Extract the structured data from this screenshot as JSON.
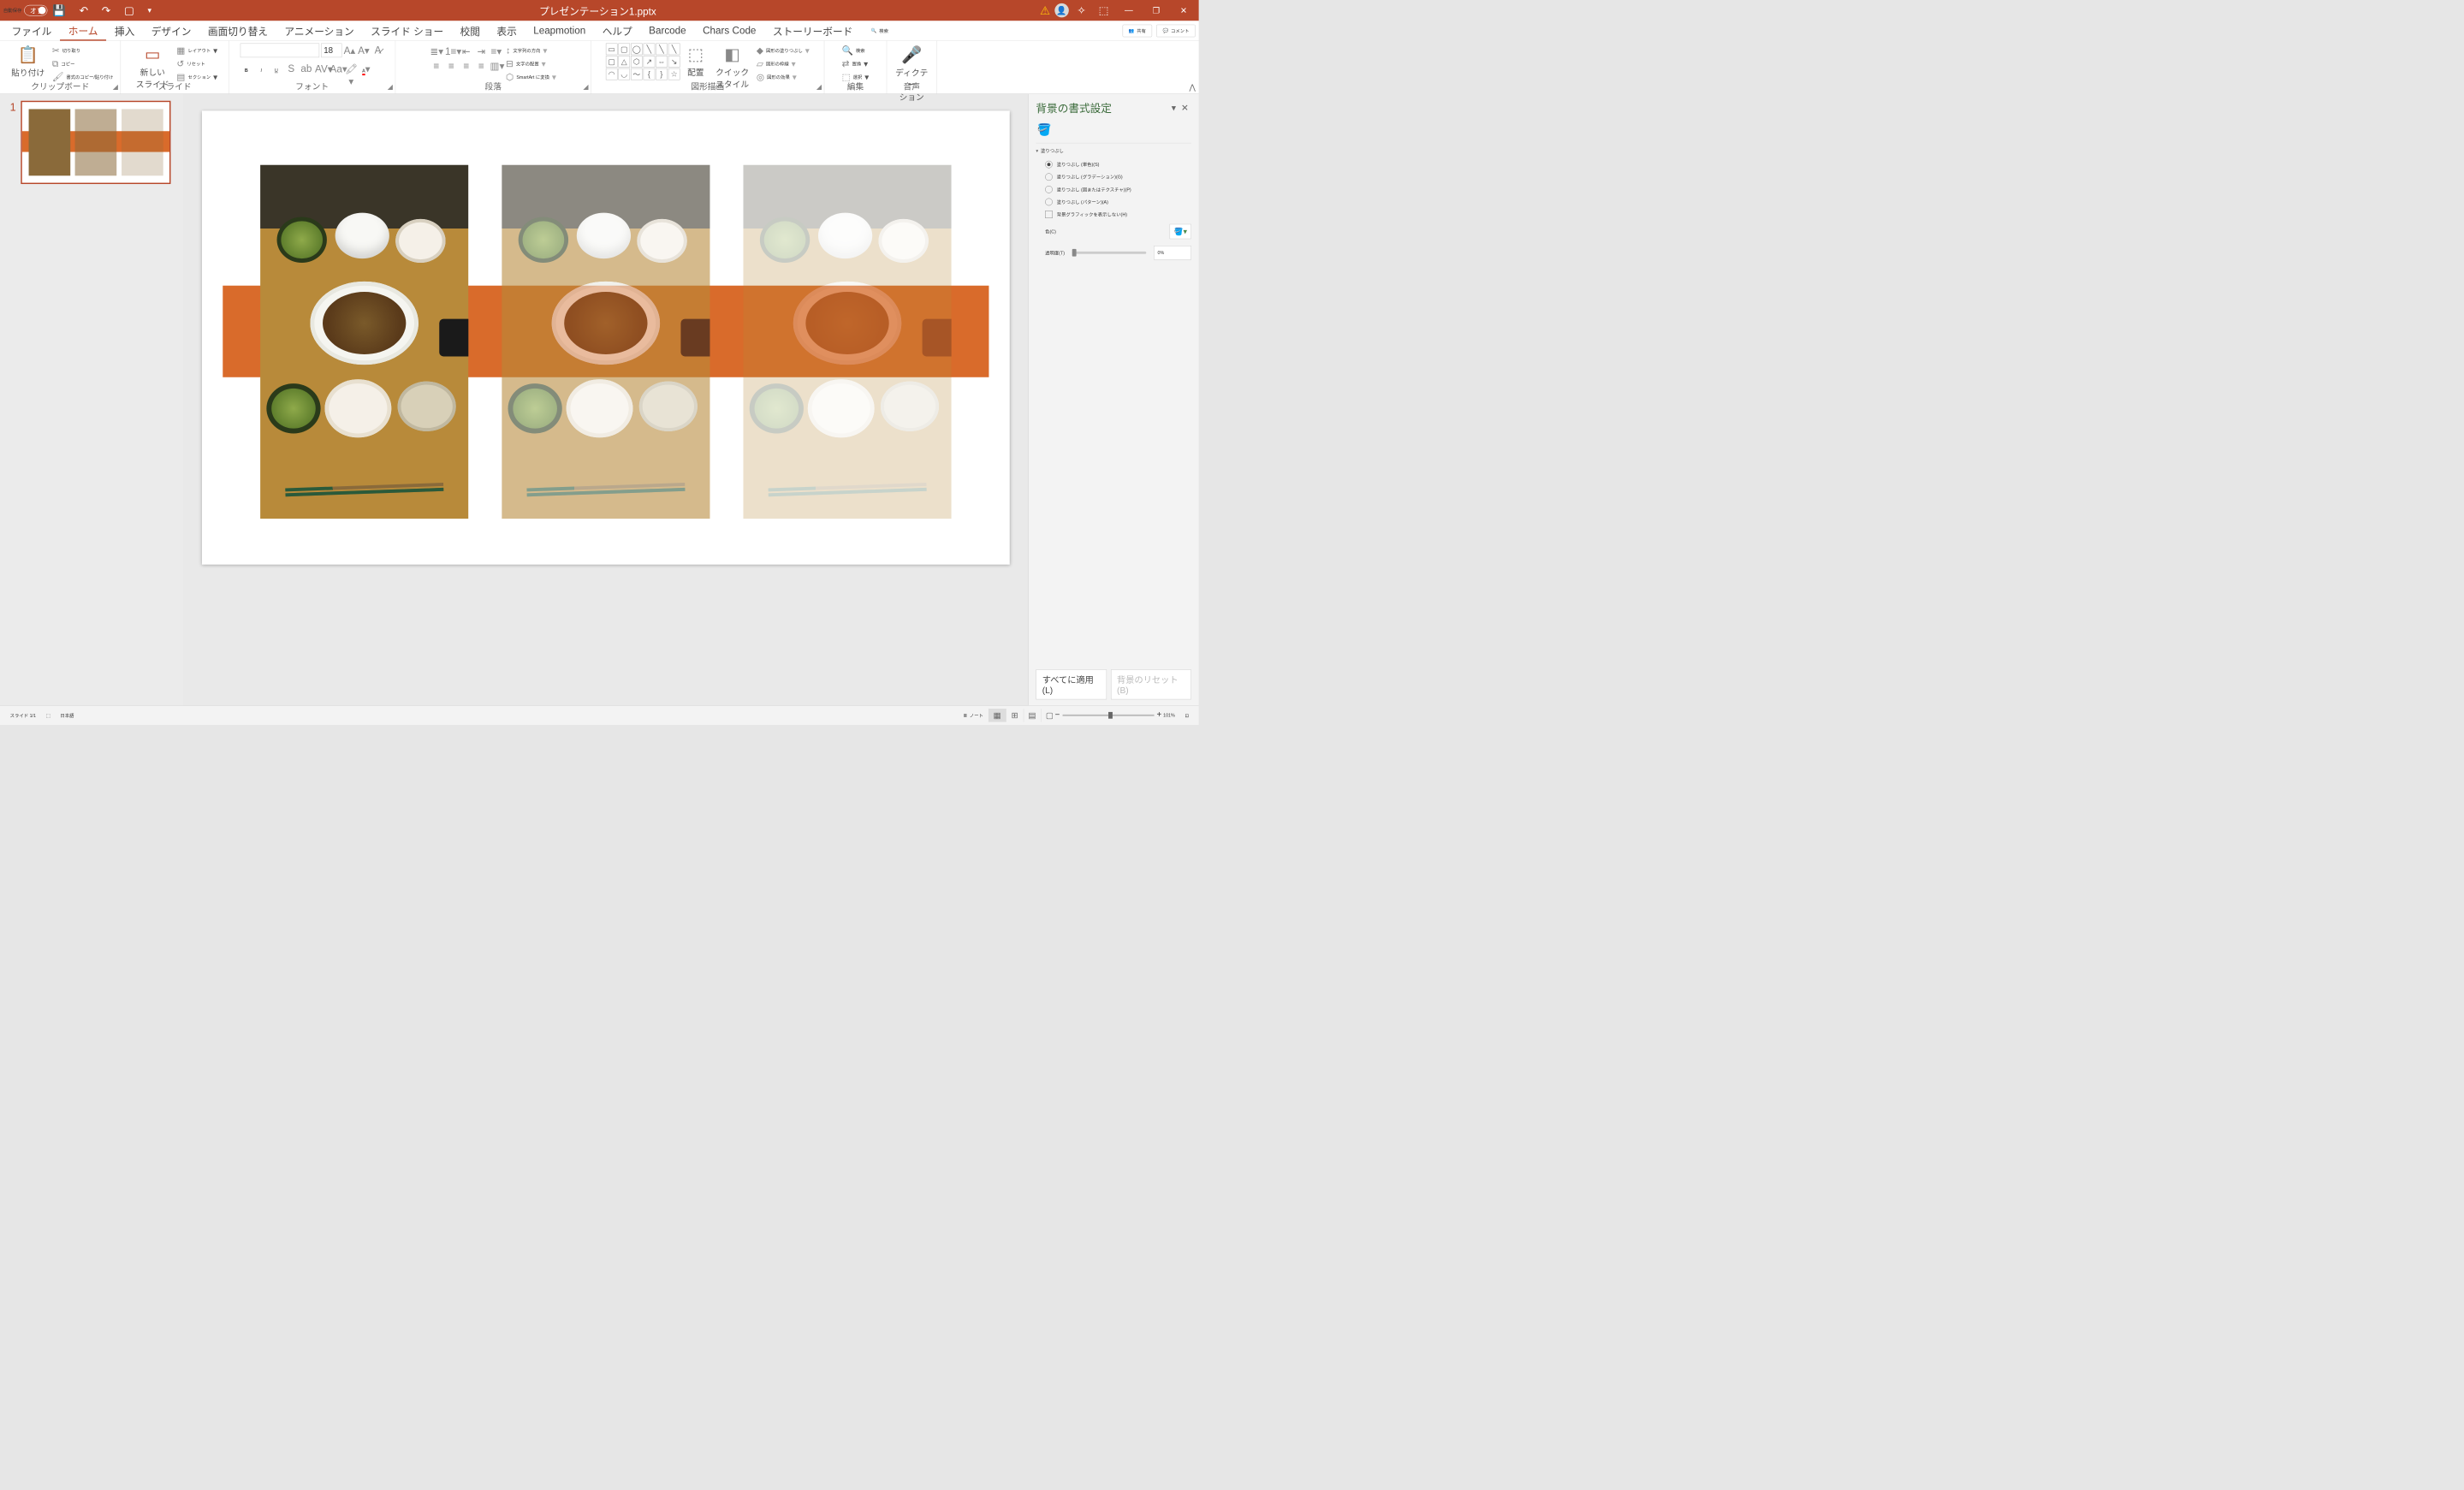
{
  "titlebar": {
    "autosave_label": "自動保存",
    "autosave_state": "オフ",
    "doc_title": "プレゼンテーション1.pptx"
  },
  "tabs": {
    "file": "ファイル",
    "home": "ホーム",
    "insert": "挿入",
    "design": "デザイン",
    "transitions": "画面切り替え",
    "animations": "アニメーション",
    "slideshow": "スライド ショー",
    "review": "校閲",
    "view": "表示",
    "leapmotion": "Leapmotion",
    "help": "ヘルプ",
    "barcode": "Barcode",
    "charscode": "Chars Code",
    "storyboard": "ストーリーボード",
    "search": "検索",
    "share": "共有",
    "comments": "コメント"
  },
  "ribbon": {
    "clipboard": {
      "paste": "貼り付け",
      "cut": "切り取り",
      "copy": "コピー",
      "format_painter": "書式のコピー/貼り付け",
      "group_label": "クリップボード"
    },
    "slides": {
      "new_slide": "新しい\nスライド",
      "layout": "レイアウト",
      "reset": "リセット",
      "section": "セクション",
      "group_label": "スライド"
    },
    "font": {
      "size": "18",
      "group_label": "フォント"
    },
    "paragraph": {
      "text_direction": "文字列の方向",
      "align_text": "文字の配置",
      "convert_smartart": "SmartArt に変換",
      "group_label": "段落"
    },
    "drawing": {
      "arrange": "配置",
      "quick_styles": "クイック\nスタイル",
      "shape_fill": "図形の塗りつぶし",
      "shape_outline": "図形の枠線",
      "shape_effects": "図形の効果",
      "group_label": "図形描画"
    },
    "editing": {
      "find": "検索",
      "replace": "置換",
      "select": "選択",
      "group_label": "編集"
    },
    "voice": {
      "dictate": "ディクテー\nション",
      "group_label": "音声"
    }
  },
  "thumb": {
    "number": "1"
  },
  "sidepanel": {
    "title": "背景の書式設定",
    "section_fill": "塗りつぶし",
    "fill_solid": "塗りつぶし (単色)(S)",
    "fill_gradient": "塗りつぶし (グラデーション)(G)",
    "fill_picture": "塗りつぶし (図またはテクスチャ)(P)",
    "fill_pattern": "塗りつぶし (パターン)(A)",
    "hide_bg": "背景グラフィックを表示しない(H)",
    "color_label": "色(C)",
    "transparency_label": "透明度(T)",
    "transparency_value": "0%",
    "apply_all": "すべてに適用(L)",
    "reset_bg": "背景のリセット(B)"
  },
  "statusbar": {
    "slide_info": "スライド 1/1",
    "language": "日本語",
    "notes": "ノート",
    "zoom": "101%"
  }
}
